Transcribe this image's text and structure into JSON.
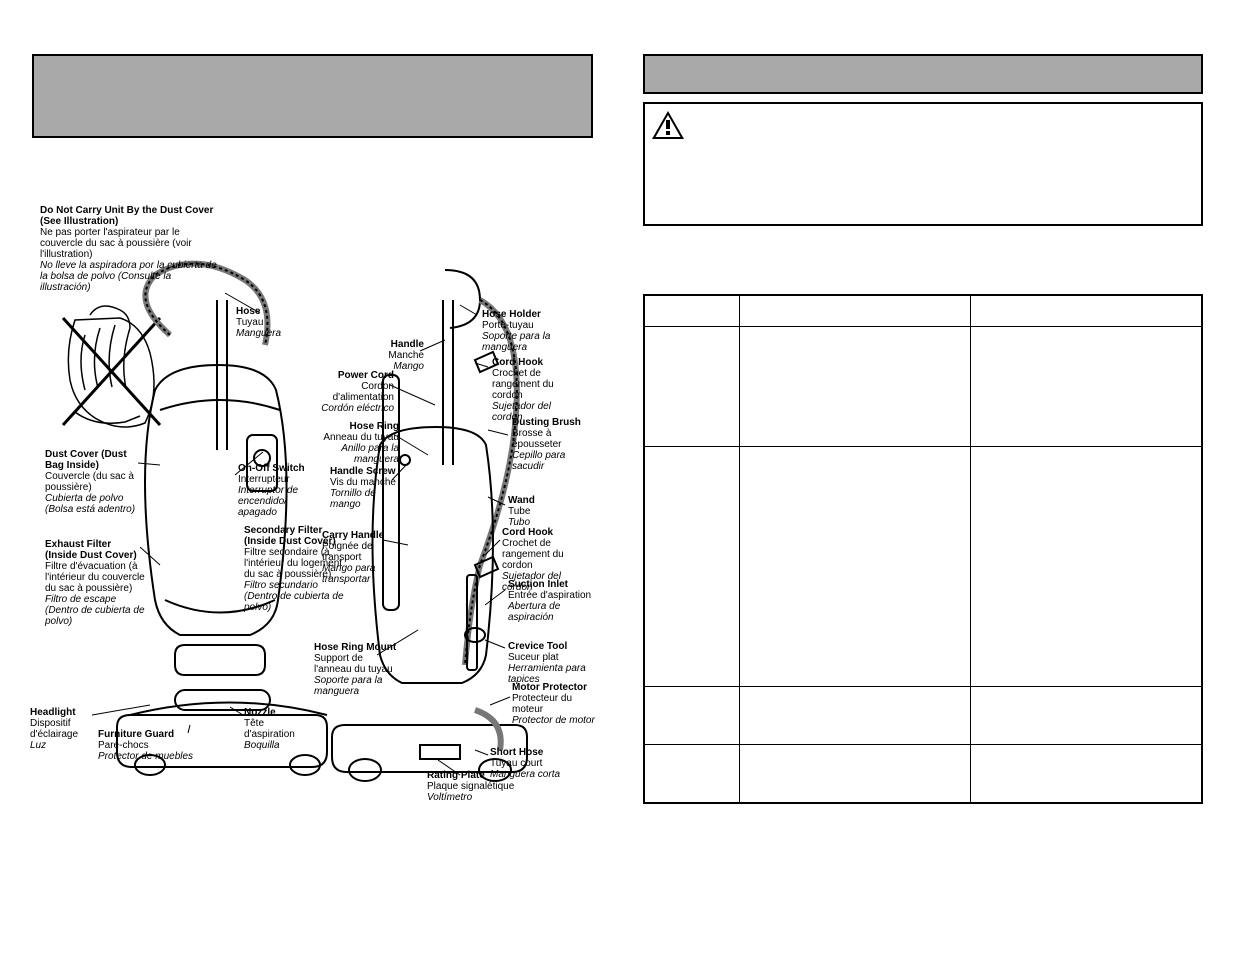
{
  "left": {
    "warning": {
      "en": "Do Not Carry Unit By the Dust Cover (See Illustration)",
      "fr": "Ne pas porter l'aspirateur par le couvercle du sac à poussière (voir l'illustration)",
      "es": "No lleve la aspiradora por la cubierta de la bolsa de polvo (Consulte la illustración)"
    },
    "labels": {
      "hose": {
        "en": "Hose",
        "fr": "Tuyau",
        "es": "Manguera"
      },
      "hose_holder": {
        "en": "Hose Holder",
        "fr": "Porte-tuyau",
        "es": "Soporte para la manguera"
      },
      "handle": {
        "en": "Handle",
        "fr": "Manche",
        "es": "Mango"
      },
      "cord_hook_upper": {
        "en": "Cord Hook",
        "fr": "Crochet de rangement du cordon",
        "es": "Sujetador del cordon"
      },
      "power_cord": {
        "en": "Power Cord",
        "fr": "Cordon d'alimentation",
        "es": "Cordón eléctrico"
      },
      "hose_ring": {
        "en": "Hose Ring",
        "fr": "Anneau du tuyau",
        "es": "Anillo para la manguera"
      },
      "dusting_brush": {
        "en": "Dusting Brush",
        "fr": "Brosse à épousseter",
        "es": "Cepillo para sacudir"
      },
      "dust_cover": {
        "en": "Dust Cover (Dust Bag Inside)",
        "fr": "Couvercle (du sac à poussière)",
        "es": "Cubierta de polvo (Bolsa está adentro)"
      },
      "on_off": {
        "en": "On-Off Switch",
        "fr": "Interrupteur",
        "es": "Interruptor de encendido/ apagado"
      },
      "handle_screw": {
        "en": "Handle Screw",
        "fr": "Vis du manche",
        "es": "Tornillo de mango"
      },
      "wand": {
        "en": "Wand",
        "fr": "Tube",
        "es": "Tubo"
      },
      "secondary_filter": {
        "en": "Secondary Filter (Inside Dust Cover)",
        "fr": "Filtre secondaire (à l'intérieur du logement du sac à poussière)",
        "es": "Filtro secundario (Dentro de cubierta de polvo)"
      },
      "carry_handle": {
        "en": "Carry Handle",
        "fr": "Poignée de transport",
        "es": "Mango para transportar"
      },
      "cord_hook_lower": {
        "en": "Cord Hook",
        "fr": "Crochet de rangement du cordon",
        "es": "Sujetador del cordon"
      },
      "exhaust_filter": {
        "en": "Exhaust Filter (Inside Dust Cover)",
        "fr": "Filtre d'évacuation (à l'intérieur du couvercle du sac à poussière)",
        "es": "Filtro de escape (Dentro de cubierta de polvo)"
      },
      "suction_inlet": {
        "en": "Suction Inlet",
        "fr": "Entrée d'aspiration",
        "es": "Abertura de aspiración"
      },
      "crevice_tool": {
        "en": "Crevice Tool",
        "fr": "Suceur plat",
        "es": "Herramienta para tapices"
      },
      "hose_ring_mount": {
        "en": "Hose Ring Mount",
        "fr": "Support de l'anneau du tuyau",
        "es": "Soporte para la manguera"
      },
      "motor_protector": {
        "en": "Motor Protector",
        "fr": "Protecteur du moteur",
        "es": "Protector de motor"
      },
      "headlight": {
        "en": "Headlight",
        "fr": "Dispositif d'éclairage",
        "es": "Luz"
      },
      "nozzle": {
        "en": "Nozzle",
        "fr": "Tête d'aspiration",
        "es": "Boquilla"
      },
      "furniture_guard": {
        "en": "Furniture Guard",
        "fr": "Pare-chocs",
        "es": "Protector de muebles"
      },
      "short_hose": {
        "en": "Short Hose",
        "fr": "Tuyau court",
        "es": "Manguera corta"
      },
      "rating_plate": {
        "en": "Rating Plate",
        "fr": "Plaque signalétique",
        "es": "Voltímetro"
      }
    }
  },
  "right": {}
}
